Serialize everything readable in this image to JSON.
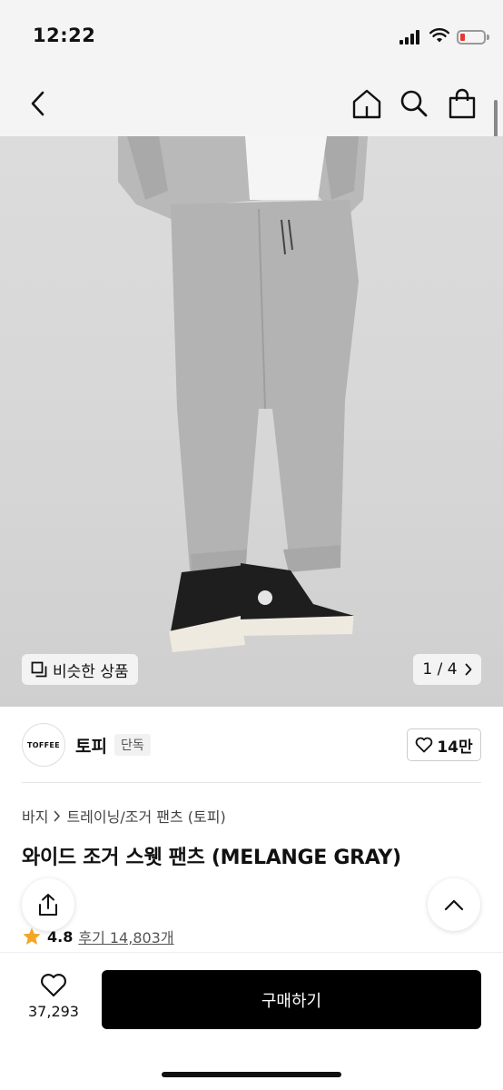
{
  "status_bar": {
    "time": "12:22",
    "battery_color": "#e53935"
  },
  "nav": {
    "icons": [
      "back-icon",
      "home-icon",
      "search-icon",
      "shopping-bag-icon"
    ]
  },
  "gallery": {
    "similar_label": "비슷한 상품",
    "page_indicator": "1 / 4"
  },
  "brand": {
    "logo_text": "TOFFEE",
    "name": "토피",
    "badge": "단독",
    "likes": "14만"
  },
  "product": {
    "breadcrumb": [
      "바지",
      "트레이닝/조거 팬츠 (토피)"
    ],
    "title": "와이드 조거 스웻 팬츠 (MELANGE GRAY)",
    "rating": "4.8",
    "review_text": "후기 14,803개",
    "star_color": "#f5a623"
  },
  "bottom_bar": {
    "wish_count": "37,293",
    "buy_label": "구매하기"
  }
}
